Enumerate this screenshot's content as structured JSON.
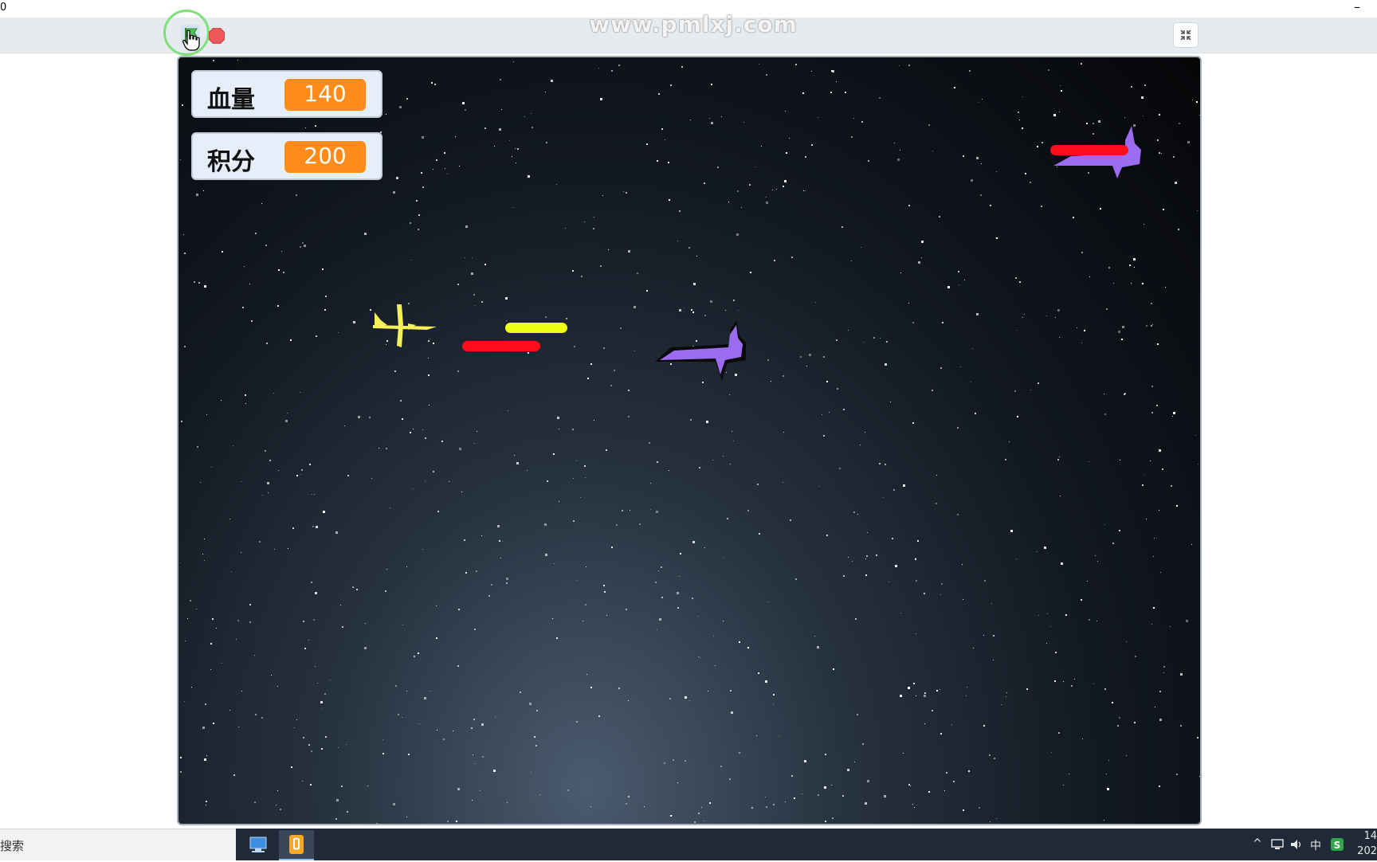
{
  "window": {
    "title_fragment": "0",
    "minimize_symbol": "–"
  },
  "toolbar": {
    "watermark": "www.pmlxj.com"
  },
  "monitors": [
    {
      "label": "血量",
      "value": "140"
    },
    {
      "label": "积分",
      "value": "200"
    }
  ],
  "taskbar": {
    "search_fragment": "搜索",
    "tray": {
      "ime": "中",
      "clock_top": "14",
      "clock_bottom": "202"
    }
  },
  "colors": {
    "player": "#f5f05a",
    "enemy": "#9b6cf0",
    "bullet_red": "#ff0d1a",
    "bullet_yellow": "#eeff14",
    "monitor_value": "#ff8c1a"
  }
}
